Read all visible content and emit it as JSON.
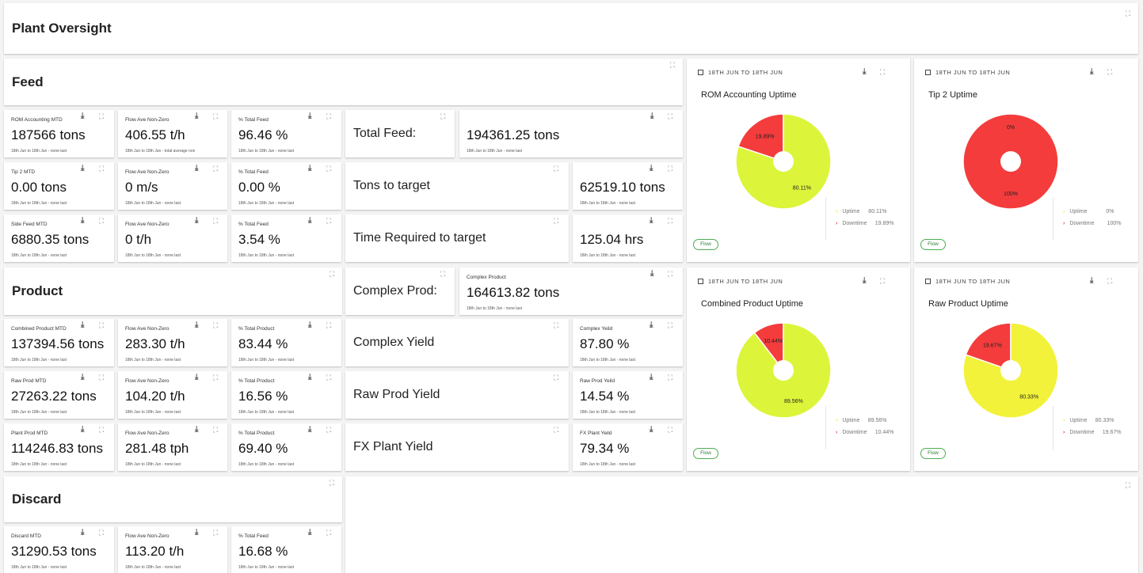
{
  "page": {
    "title": "Plant Oversight"
  },
  "sections": {
    "feed": "Feed",
    "product": "Product",
    "discard": "Discard"
  },
  "feed_tiles": [
    {
      "label": "ROM Accounting MTD",
      "value": "187566 tons",
      "sub": "18th Jun to 18th Jun - none last"
    },
    {
      "label": "Flow Ave Non-Zero",
      "value": "406.55 t/h",
      "sub": "18th Jun to 18th Jun - total average non"
    },
    {
      "label": "% Total Feed",
      "value": "96.46 %",
      "sub": "18th Jun to 18th Jun - none last"
    },
    {
      "label": "Tip 2 MTD",
      "value": "0.00 tons",
      "sub": "18th Jun to 18th Jun - none last"
    },
    {
      "label": "Flow Ave Non-Zero",
      "value": "0 m/s",
      "sub": "18th Jun to 18th Jun - none last"
    },
    {
      "label": "% Total Feed",
      "value": "0.00 %",
      "sub": "18th Jun to 18th Jun - none last"
    },
    {
      "label": "Side Feed MTD",
      "value": "6880.35 tons",
      "sub": "18th Jun to 18th Jun - none last"
    },
    {
      "label": "Flow Ave Non-Zero",
      "value": "0 t/h",
      "sub": "18th Jun to 18th Jun - none last"
    },
    {
      "label": "% Total Feed",
      "value": "3.54 %",
      "sub": "18th Jun to 18th Jun - none last"
    }
  ],
  "product_tiles": [
    {
      "label": "Combined Product MTD",
      "value": "137394.56 tons",
      "sub": "18th Jun to 18th Jun - none last"
    },
    {
      "label": "Flow Ave Non-Zero",
      "value": "283.30 t/h",
      "sub": "18th Jun to 18th Jun - none last"
    },
    {
      "label": "% Total Product",
      "value": "83.44 %",
      "sub": "18th Jun to 18th Jun - none last"
    },
    {
      "label": "Raw Prod MTD",
      "value": "27263.22 tons",
      "sub": "18th Jun to 18th Jun - none last"
    },
    {
      "label": "Flow Ave Non-Zero",
      "value": "104.20 t/h",
      "sub": "18th Jun to 18th Jun - none last"
    },
    {
      "label": "% Total Product",
      "value": "16.56 %",
      "sub": "18th Jun to 18th Jun - none last"
    },
    {
      "label": "Plant Prod MTD",
      "value": "114246.83 tons",
      "sub": "18th Jun to 18th Jun - none last"
    },
    {
      "label": "Flow Ave Non-Zero",
      "value": "281.48 tph",
      "sub": "18th Jun to 18th Jun - none last"
    },
    {
      "label": "% Total Product",
      "value": "69.40 %",
      "sub": "18th Jun to 18th Jun - none last"
    }
  ],
  "discard_tiles": [
    {
      "label": "Discard MTD",
      "value": "31290.53 tons",
      "sub": "18th Jun to 18th Jun - none last"
    },
    {
      "label": "Flow Ave Non-Zero",
      "value": "113.20 t/h",
      "sub": "18th Jun to 18th Jun - none last"
    },
    {
      "label": "% Total Feed",
      "value": "16.68 %",
      "sub": "18th Jun to 18th Jun - none last"
    }
  ],
  "middle": {
    "total_feed_label": "Total Feed:",
    "total_feed_value": "194361.25 tons",
    "total_feed_sub": "18th Jun to 18th Jun - none last",
    "tons_to_target_label": "Tons to target",
    "tons_to_target_value": "62519.10 tons",
    "tons_to_target_sub": "18th Jun to 18th Jun - none last",
    "time_required_label": "Time Required to target",
    "time_required_value": "125.04 hrs",
    "time_required_sub": "18th Jun to 18th Jun - none last",
    "complex_prod_label": "Complex Prod:",
    "complex_prod_tile_label": "Complex Product",
    "complex_prod_value": "164613.82 tons",
    "complex_prod_sub": "18th Jun to 18th Jun - none last",
    "complex_yield_label": "Complex Yield",
    "complex_yield_tile_label": "Complex Yeild",
    "complex_yield_value": "87.80 %",
    "complex_yield_sub": "18th Jun to 18th Jun - none last",
    "raw_yield_label": "Raw Prod Yield",
    "raw_yield_tile_label": "Raw Prod Yeild",
    "raw_yield_value": "14.54 %",
    "raw_yield_sub": "18th Jun to 18th Jun - none last",
    "fx_yield_label": "FX Plant Yield",
    "fx_yield_tile_label": "FX Plant Yeild",
    "fx_yield_value": "79.34 %",
    "fx_yield_sub": "18th Jun to 18th Jun - none last"
  },
  "legend_labels": {
    "uptime": "Uptime",
    "downtime": "Downtime"
  },
  "icons": {
    "download": "download-icon",
    "expand": "expand-icon",
    "calendar": "calendar-icon"
  },
  "colors": {
    "uptime_green": "#dcf53a",
    "uptime_yellow": "#f2f23a",
    "downtime": "#f43c3c",
    "chip": "#4caf50"
  },
  "chart_data": [
    {
      "type": "pie",
      "date_range": "18TH JUN TO 18TH JUN",
      "title": "ROM Accounting Uptime",
      "chip": "Flow",
      "categories": [
        "Uptime",
        "Downtime"
      ],
      "values": [
        80.11,
        19.89
      ],
      "value_labels": [
        "80.11%",
        "19.89%"
      ],
      "legend_values": [
        "80.11%",
        "19.89%"
      ],
      "uptime_color": "#dcf53a"
    },
    {
      "type": "pie",
      "date_range": "18TH JUN TO 18TH JUN",
      "title": "Tip 2 Uptime",
      "chip": "Flow",
      "categories": [
        "Uptime",
        "Downtime"
      ],
      "values": [
        0,
        100
      ],
      "value_labels": [
        "0%",
        "100%"
      ],
      "legend_values": [
        "0%",
        "100%"
      ],
      "uptime_color": "#dcf53a"
    },
    {
      "type": "pie",
      "date_range": "18TH JUN TO 18TH JUN",
      "title": "Combined Product Uptime",
      "chip": "Flow",
      "categories": [
        "Uptime",
        "Downtime"
      ],
      "values": [
        89.56,
        10.44
      ],
      "value_labels": [
        "89.56%",
        "10.44%"
      ],
      "legend_values": [
        "89.56%",
        "10.44%"
      ],
      "uptime_color": "#dcf53a"
    },
    {
      "type": "pie",
      "date_range": "18TH JUN TO 18TH JUN",
      "title": "Raw Product Uptime",
      "chip": "Flow",
      "categories": [
        "Uptime",
        "Downtime"
      ],
      "values": [
        80.33,
        19.67
      ],
      "value_labels": [
        "80.33%",
        "19.67%"
      ],
      "legend_values": [
        "80.33%",
        "19.67%"
      ],
      "uptime_color": "#f2f23a"
    }
  ]
}
